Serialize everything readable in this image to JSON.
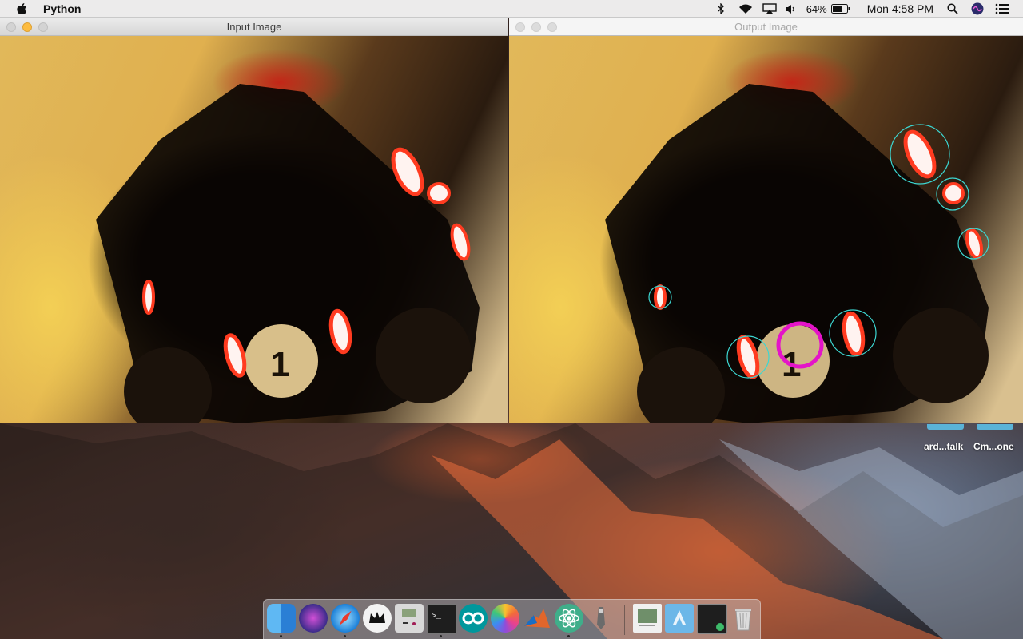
{
  "menubar": {
    "app_name": "Python",
    "battery_percent": "64%",
    "clock": "Mon 4:58 PM"
  },
  "windows": {
    "input": {
      "title": "Input Image"
    },
    "output": {
      "title": "Output Image"
    }
  },
  "desktop": {
    "shortcut_1": "ard...talk",
    "shortcut_2": "Cm...one"
  },
  "dock": {
    "items": [
      "finder-icon",
      "siri-icon",
      "safari-icon",
      "crown-app-icon",
      "gameboy-icon",
      "terminal-icon",
      "arduino-icon",
      "photos-icon",
      "matlab-icon",
      "atom-icon",
      "pen-tool-icon",
      "preview-doc-icon",
      "applications-folder-icon",
      "terminal-window-icon",
      "trash-icon"
    ]
  },
  "colors": {
    "detection_circle": "#3cd7d2",
    "target_circle": "#e414c8",
    "accent_red": "#e0354a"
  }
}
